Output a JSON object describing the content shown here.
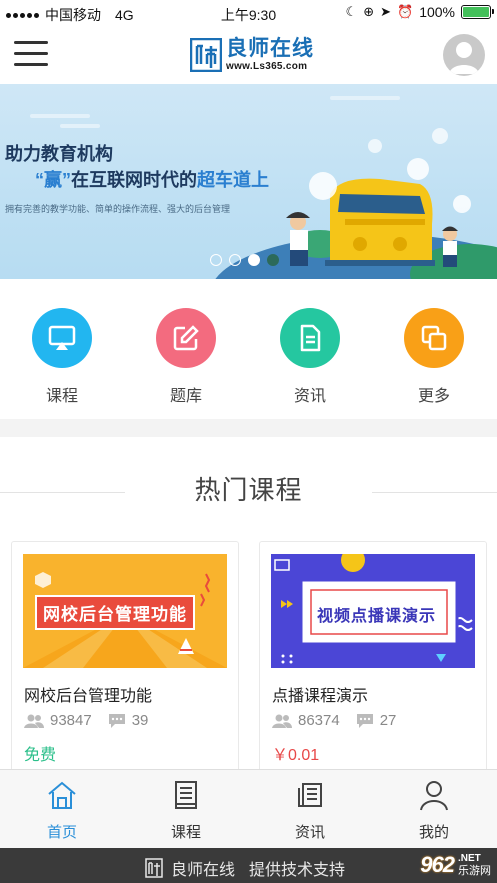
{
  "status_bar": {
    "carrier": "中国移动",
    "network": "4G",
    "time": "上午9:30",
    "battery": "100%"
  },
  "header": {
    "logo_name": "良师在线",
    "logo_url": "www.Ls365.com"
  },
  "banner": {
    "title_line1": "助力教育机构",
    "title_line2_quote": "“赢”",
    "title_line2_mid": "在互联网时代的",
    "title_line2_strong": "超车道上",
    "subtitle": "拥有完善的教学功能、简单的操作流程、强大的后台管理",
    "slides": 4,
    "active_slide": 3
  },
  "quick_nav": [
    {
      "label": "课程",
      "icon": "airplay-icon",
      "color": "#22b6f0"
    },
    {
      "label": "题库",
      "icon": "edit-icon",
      "color": "#f36b7f"
    },
    {
      "label": "资讯",
      "icon": "document-icon",
      "color": "#25c7a0"
    },
    {
      "label": "更多",
      "icon": "copy-icon",
      "color": "#f9a017"
    }
  ],
  "hot_courses": {
    "title": "热门课程",
    "items": [
      {
        "title": "网校后台管理功能",
        "thumb_text": "网校后台管理功能",
        "students": "93847",
        "comments": "39",
        "price": "免费",
        "price_color": "#2bbf8a"
      },
      {
        "title": "点播课程演示",
        "thumb_text": "视频点播课演示",
        "students": "86374",
        "comments": "27",
        "price": "￥0.01",
        "price_color": "#e84848"
      }
    ]
  },
  "tab_bar": [
    {
      "label": "首页",
      "icon": "home-icon",
      "active": true
    },
    {
      "label": "课程",
      "icon": "book-icon",
      "active": false
    },
    {
      "label": "资讯",
      "icon": "news-icon",
      "active": false
    },
    {
      "label": "我的",
      "icon": "user-icon",
      "active": false
    }
  ],
  "footer": {
    "brand": "良师在线",
    "text": "提供技术支持"
  },
  "watermark": {
    "number": "962",
    "domain": ".NET",
    "name": "乐游网"
  },
  "colors": {
    "brand_blue": "#1a6fb5",
    "tab_active": "#2a8fd8"
  }
}
